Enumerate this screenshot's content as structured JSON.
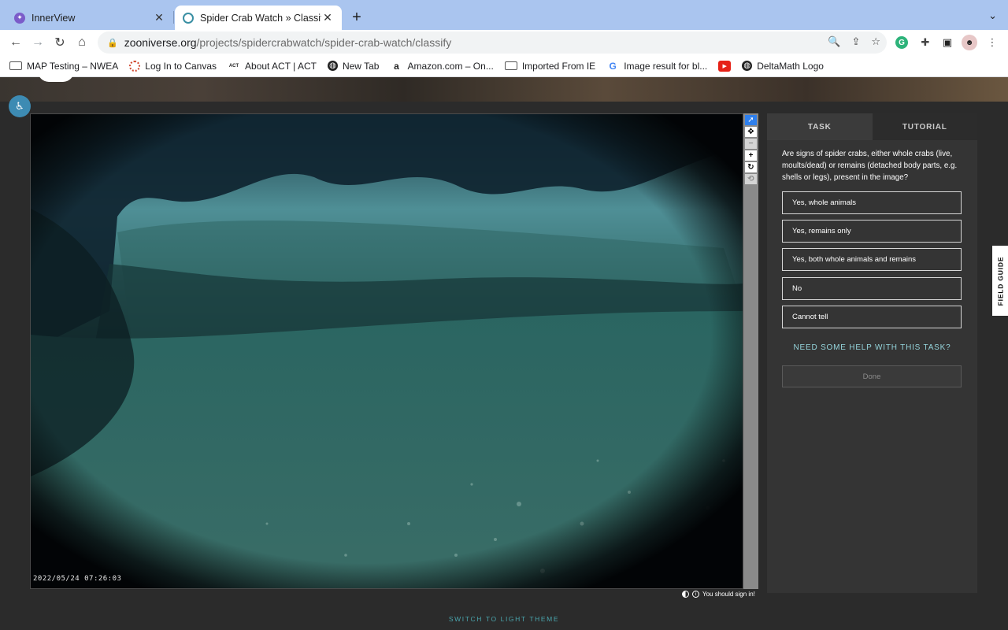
{
  "browser": {
    "tabs": [
      {
        "title": "InnerView",
        "active": false
      },
      {
        "title": "Spider Crab Watch » Classify",
        "active": true
      }
    ],
    "url_host": "zooniverse.org",
    "url_path": "/projects/spidercrabwatch/spider-crab-watch/classify",
    "bookmarks": [
      {
        "label": "MAP Testing – NWEA",
        "icon": "folder-icon"
      },
      {
        "label": "Log In to Canvas",
        "icon": "canvas-icon"
      },
      {
        "label": "About ACT | ACT",
        "icon": "act-icon"
      },
      {
        "label": "New Tab",
        "icon": "globe-icon"
      },
      {
        "label": "Amazon.com – On...",
        "icon": "amazon-icon"
      },
      {
        "label": "Imported From IE",
        "icon": "folder-icon"
      },
      {
        "label": "Image result for bl...",
        "icon": "google-icon"
      },
      {
        "label": "",
        "icon": "youtube-icon"
      },
      {
        "label": "DeltaMath Logo",
        "icon": "globe-icon"
      }
    ]
  },
  "subject": {
    "timestamp": "2022/05/24 07:26:03"
  },
  "panel": {
    "tabs": {
      "task": "TASK",
      "tutorial": "TUTORIAL"
    },
    "question": "Are signs of spider crabs, either whole crabs (live, moults/dead) or remains (detached body parts, e.g. shells or legs), present in the image?",
    "answers": [
      "Yes, whole animals",
      "Yes, remains only",
      "Yes, both whole animals and remains",
      "No",
      "Cannot tell"
    ],
    "help": "NEED SOME HELP WITH THIS TASK?",
    "done": "Done"
  },
  "field_guide": "FIELD GUIDE",
  "signin_note": "You should sign in!",
  "theme_switch": "SWITCH TO LIGHT THEME",
  "colors": {
    "accent_teal": "#95d5dc",
    "panel_bg": "#343434",
    "page_bg": "#2b2b2b",
    "tool_active": "#2f80ed"
  }
}
